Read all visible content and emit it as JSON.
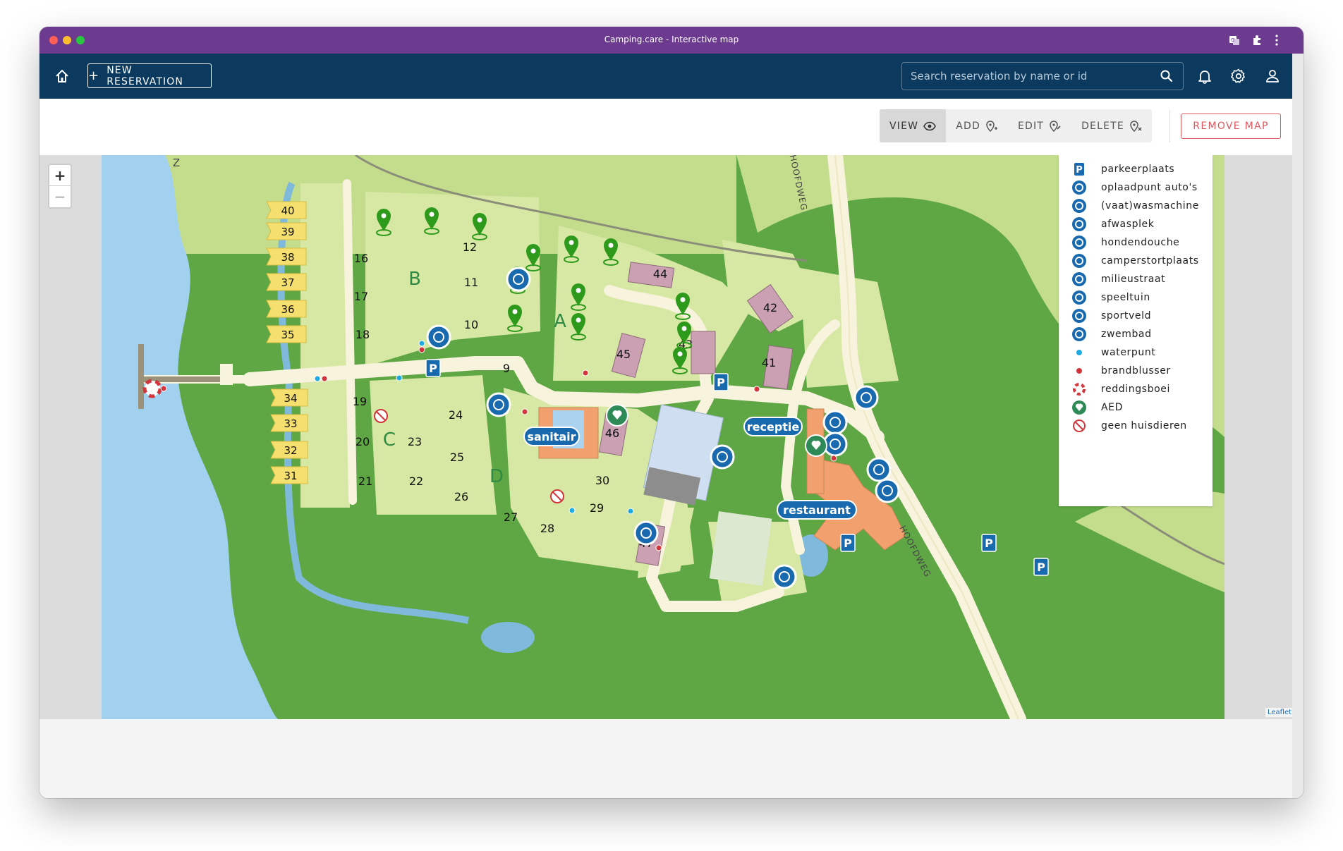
{
  "window": {
    "title": "Camping.care - Interactive map"
  },
  "header": {
    "new_reservation_label": "NEW RESERVATION",
    "search_placeholder": "Search reservation by name or id"
  },
  "toolbar": {
    "view_label": "VIEW",
    "add_label": "ADD",
    "edit_label": "EDIT",
    "delete_label": "DELETE",
    "remove_map_label": "REMOVE MAP"
  },
  "colors": {
    "titlebar": "#6c3b8f",
    "appbar": "#0b3a5e",
    "accent_red": "#e0585f",
    "marker_green": "#2e9a1c",
    "icon_blue": "#1869ad"
  },
  "map": {
    "zoom_in_label": "+",
    "zoom_out_label": "−",
    "attribution": "Leaflet",
    "north_label": "Z",
    "field_labels": [
      "A",
      "B",
      "C",
      "D"
    ],
    "pitch_numbers": [
      "9",
      "10",
      "11",
      "12",
      "16",
      "17",
      "18",
      "19",
      "20",
      "21",
      "22",
      "23",
      "24",
      "25",
      "26",
      "27",
      "28",
      "29",
      "30"
    ],
    "row_pitches_top": [
      "40",
      "39",
      "38",
      "37",
      "36",
      "35"
    ],
    "row_pitches_bottom": [
      "34",
      "33",
      "32",
      "31"
    ],
    "bungalows": [
      "41",
      "42",
      "43",
      "44",
      "45",
      "46",
      "47"
    ],
    "building_labels": [
      "sanitair",
      "receptie",
      "restaurant"
    ],
    "road_label": "HOOFDWEG"
  },
  "legend": {
    "items": [
      {
        "label": "parkeerplaats",
        "icon": "parking-icon"
      },
      {
        "label": "oplaadpunt auto's",
        "icon": "car-charging-icon"
      },
      {
        "label": "(vaat)wasmachine",
        "icon": "washing-machine-icon"
      },
      {
        "label": "afwasplek",
        "icon": "dishwashing-icon"
      },
      {
        "label": "hondendouche",
        "icon": "dog-shower-icon"
      },
      {
        "label": "camperstortplaats",
        "icon": "camper-dump-icon"
      },
      {
        "label": "milieustraat",
        "icon": "recycling-icon"
      },
      {
        "label": "speeltuin",
        "icon": "playground-icon"
      },
      {
        "label": "sportveld",
        "icon": "sports-field-icon"
      },
      {
        "label": "zwembad",
        "icon": "swimming-pool-icon"
      },
      {
        "label": "waterpunt",
        "icon": "water-point-icon"
      },
      {
        "label": "brandblusser",
        "icon": "fire-extinguisher-icon"
      },
      {
        "label": "reddingsboei",
        "icon": "lifebuoy-icon"
      },
      {
        "label": "AED",
        "icon": "aed-icon"
      },
      {
        "label": "geen huisdieren",
        "icon": "no-pets-icon"
      }
    ]
  }
}
